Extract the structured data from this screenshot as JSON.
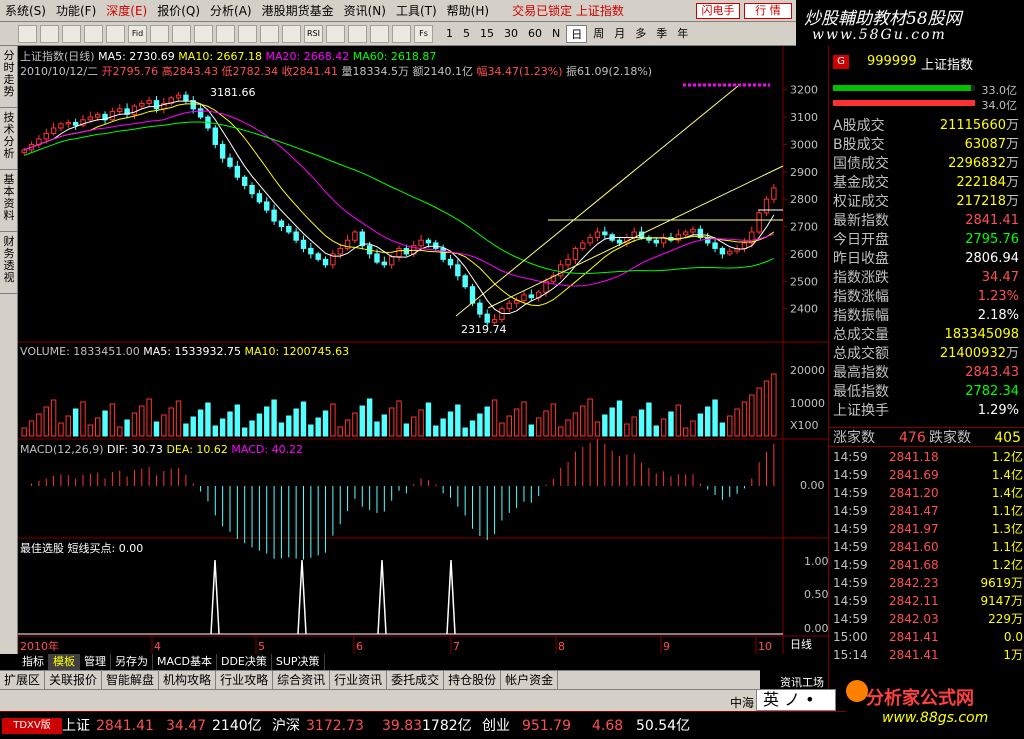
{
  "menu": {
    "items": [
      {
        "label": "系统(S)",
        "active": false
      },
      {
        "label": "功能(F)",
        "active": false
      },
      {
        "label": "深度(E)",
        "active": true
      },
      {
        "label": "报价(Q)",
        "active": false
      },
      {
        "label": "分析(A)",
        "active": false
      },
      {
        "label": "港股期货基金",
        "active": false
      },
      {
        "label": "资讯(N)",
        "active": false
      },
      {
        "label": "工具(T)",
        "active": false
      },
      {
        "label": "帮助(H)",
        "active": false
      }
    ],
    "status": "交易已锁定 上证指数",
    "flash_label": "闪电手",
    "quote_label": "行 情"
  },
  "brand": {
    "title": "炒股輔助教材58股网",
    "url": "www.58Gu.com"
  },
  "toolbar": {
    "buttons": [
      "",
      "",
      "",
      "",
      "",
      "Fid",
      "",
      "",
      "",
      "",
      "",
      "",
      "",
      "RSI",
      "",
      "",
      "",
      "",
      "Fs"
    ],
    "periods": [
      "1",
      "5",
      "15",
      "30",
      "60",
      "N",
      "日",
      "周",
      "月",
      "多",
      "季",
      "年"
    ],
    "active_period": "日"
  },
  "sidebar": {
    "tabs": [
      "分时走势",
      "技术分析",
      "基本资料",
      "财务透视"
    ]
  },
  "chart": {
    "title_line": "上证指数(日线)",
    "ma_labels": [
      {
        "text": "MA5: 2730.69",
        "color": "#ffffff"
      },
      {
        "text": "MA10: 2667.18",
        "color": "#ffff00"
      },
      {
        "text": "MA20: 2668.42",
        "color": "#ff00ff"
      },
      {
        "text": "MA60: 2618.87",
        "color": "#00ff00"
      }
    ],
    "ohlc_line": [
      {
        "text": "2010/10/12/二",
        "color": "#c0c0c0"
      },
      {
        "text": "开2795.76",
        "color": "#ff5050"
      },
      {
        "text": "高2843.43",
        "color": "#ff5050"
      },
      {
        "text": "低2782.34",
        "color": "#ff5050"
      },
      {
        "text": "收2841.41",
        "color": "#ff5050"
      },
      {
        "text": "量18334.5万",
        "color": "#c0c0c0"
      },
      {
        "text": "额2140.1亿",
        "color": "#c0c0c0"
      },
      {
        "text": "幅34.47(1.23%)",
        "color": "#ff5050"
      },
      {
        "text": "振61.09(2.18%)",
        "color": "#c0c0c0"
      }
    ],
    "high_label": "3181.66",
    "low_label": "2319.74",
    "price_axis": [
      "3200",
      "3100",
      "3000",
      "2900",
      "2800",
      "2700",
      "2600",
      "2500",
      "2400"
    ],
    "volume_line": [
      {
        "text": "VOLUME: 1833451.00",
        "color": "#c0c0c0"
      },
      {
        "text": "MA5: 1533932.75",
        "color": "#ffffff"
      },
      {
        "text": "MA10: 1200745.63",
        "color": "#ffff00"
      }
    ],
    "volume_axis": [
      "20000",
      "10000",
      "X100"
    ],
    "macd_line": [
      {
        "text": "MACD(12,26,9)",
        "color": "#c0c0c0"
      },
      {
        "text": "DIF: 30.73",
        "color": "#ffffff"
      },
      {
        "text": "DEA: 10.62",
        "color": "#ffff00"
      },
      {
        "text": "MACD: 40.22",
        "color": "#ff00ff"
      }
    ],
    "macd_axis": [
      "0.00"
    ],
    "signal_line": "最佳选股  短线买点: 0.00",
    "signal_axis": [
      "1.00",
      "0.50",
      "0.00"
    ],
    "months": [
      "2010年",
      "4",
      "5",
      "6",
      "7",
      "8",
      "9",
      "10"
    ],
    "day_label": "日线"
  },
  "chart_data": {
    "type": "candlestick",
    "title": "上证指数(日线)",
    "ylim": [
      2300,
      3250
    ],
    "closes": [
      2980,
      3000,
      3020,
      3040,
      3060,
      3075,
      3080,
      3070,
      3090,
      3100,
      3110,
      3090,
      3120,
      3130,
      3110,
      3140,
      3150,
      3160,
      3130,
      3150,
      3170,
      3180,
      3160,
      3130,
      3100,
      3060,
      3000,
      2950,
      2920,
      2880,
      2850,
      2820,
      2790,
      2760,
      2720,
      2700,
      2680,
      2650,
      2620,
      2600,
      2580,
      2560,
      2600,
      2620,
      2650,
      2680,
      2630,
      2600,
      2570,
      2560,
      2590,
      2620,
      2600,
      2630,
      2650,
      2640,
      2620,
      2580,
      2560,
      2520,
      2480,
      2420,
      2380,
      2350,
      2360,
      2400,
      2420,
      2430,
      2450,
      2440,
      2460,
      2500,
      2520,
      2560,
      2580,
      2620,
      2640,
      2660,
      2680,
      2670,
      2650,
      2640,
      2660,
      2680,
      2660,
      2650,
      2640,
      2660,
      2650,
      2670,
      2680,
      2690,
      2660,
      2640,
      2620,
      2600,
      2610,
      2620,
      2640,
      2680,
      2750,
      2800,
      2841
    ]
  },
  "right_panel": {
    "code": "999999",
    "name": "上证指数",
    "badge": "G",
    "bar_up": {
      "value": 0.33,
      "label": "33.0亿"
    },
    "bar_down": {
      "value": 0.34,
      "label": "34.0亿"
    },
    "stats": [
      {
        "label": "A股成交",
        "value": "21115660",
        "unit": "万",
        "color": "#ffff00"
      },
      {
        "label": "B股成交",
        "value": "63087",
        "unit": "万",
        "color": "#ffff00"
      },
      {
        "label": "国债成交",
        "value": "2296832",
        "unit": "万",
        "color": "#ffff00"
      },
      {
        "label": "基金成交",
        "value": "222184",
        "unit": "万",
        "color": "#ffff00"
      },
      {
        "label": "权证成交",
        "value": "217218",
        "unit": "万",
        "color": "#ffff00"
      },
      {
        "label": "最新指数",
        "value": "2841.41",
        "unit": "",
        "color": "#ff5050"
      },
      {
        "label": "今日开盘",
        "value": "2795.76",
        "unit": "",
        "color": "#00ff00"
      },
      {
        "label": "昨日收盘",
        "value": "2806.94",
        "unit": "",
        "color": "#ffffff"
      },
      {
        "label": "指数涨跌",
        "value": "34.47",
        "unit": "",
        "color": "#ff5050"
      },
      {
        "label": "指数涨幅",
        "value": "1.23%",
        "unit": "",
        "color": "#ff5050"
      },
      {
        "label": "指数振幅",
        "value": "2.18%",
        "unit": "",
        "color": "#ffffff"
      },
      {
        "label": "总成交量",
        "value": "183345098",
        "unit": "",
        "color": "#ffff00"
      },
      {
        "label": "总成交额",
        "value": "21400932",
        "unit": "万",
        "color": "#ffff00"
      },
      {
        "label": "最高指数",
        "value": "2843.43",
        "unit": "",
        "color": "#ff5050"
      },
      {
        "label": "最低指数",
        "value": "2782.34",
        "unit": "",
        "color": "#00ff00"
      },
      {
        "label": "上证换手",
        "value": "1.29%",
        "unit": "",
        "color": "#ffffff"
      }
    ],
    "up_label": "涨家数",
    "up_count": "476",
    "down_label": "跌家数",
    "down_count": "405",
    "ticks": [
      {
        "time": "14:59",
        "price": "2841.18",
        "vol": "1.2亿"
      },
      {
        "time": "14:59",
        "price": "2841.69",
        "vol": "1.4亿"
      },
      {
        "time": "14:59",
        "price": "2841.20",
        "vol": "1.4亿"
      },
      {
        "time": "14:59",
        "price": "2841.47",
        "vol": "1.1亿"
      },
      {
        "time": "14:59",
        "price": "2841.97",
        "vol": "1.3亿"
      },
      {
        "time": "14:59",
        "price": "2841.60",
        "vol": "1.1亿"
      },
      {
        "time": "14:59",
        "price": "2841.68",
        "vol": "1.2亿"
      },
      {
        "time": "14:59",
        "price": "2842.23",
        "vol": "9619万"
      },
      {
        "time": "14:59",
        "price": "2842.11",
        "vol": "9147万"
      },
      {
        "time": "14:59",
        "price": "2842.03",
        "vol": "229万"
      },
      {
        "time": "15:00",
        "price": "2841.41",
        "vol": "0.0"
      },
      {
        "time": "15:14",
        "price": "2841.41",
        "vol": "1万"
      }
    ]
  },
  "bottom_tabs": [
    {
      "label": "指标",
      "active": false
    },
    {
      "label": "模板",
      "active": true
    },
    {
      "label": "管理",
      "active": false
    },
    {
      "label": "另存为",
      "active": false
    },
    {
      "label": "MACD基本",
      "active": false
    },
    {
      "label": "DDE决策",
      "active": false
    },
    {
      "label": "SUP决策",
      "active": false
    }
  ],
  "func_bar": [
    "扩展区",
    "关联报价",
    "智能解盘",
    "机构攻略",
    "行业攻略",
    "综合资讯",
    "行业资讯",
    "委托成交",
    "持仓股份",
    "帐户资金"
  ],
  "info_bar": {
    "left": "中海",
    "right": "资讯工场"
  },
  "ime": "英 ノ •",
  "logo2": {
    "title": "分析家公式网",
    "url": "www.88gs.com"
  },
  "status_bar": {
    "badge": "TDXV版",
    "items": [
      {
        "text": "上证",
        "color": "#ffffff",
        "x": 62
      },
      {
        "text": "2841.41",
        "color": "#ff5050",
        "x": 96
      },
      {
        "text": "34.47",
        "color": "#ff5050",
        "x": 166
      },
      {
        "text": "2140亿",
        "color": "#ffffff",
        "x": 212
      },
      {
        "text": "沪深",
        "color": "#ffffff",
        "x": 272
      },
      {
        "text": "3172.73",
        "color": "#ff5050",
        "x": 306
      },
      {
        "text": "39.83",
        "color": "#ff5050",
        "x": 382
      },
      {
        "text": "1782亿",
        "color": "#ffffff",
        "x": 422
      },
      {
        "text": "创业",
        "color": "#ffffff",
        "x": 482
      },
      {
        "text": "951.79",
        "color": "#ff5050",
        "x": 522
      },
      {
        "text": "4.68",
        "color": "#ff5050",
        "x": 592
      },
      {
        "text": "50.54亿",
        "color": "#ffffff",
        "x": 636
      }
    ]
  }
}
